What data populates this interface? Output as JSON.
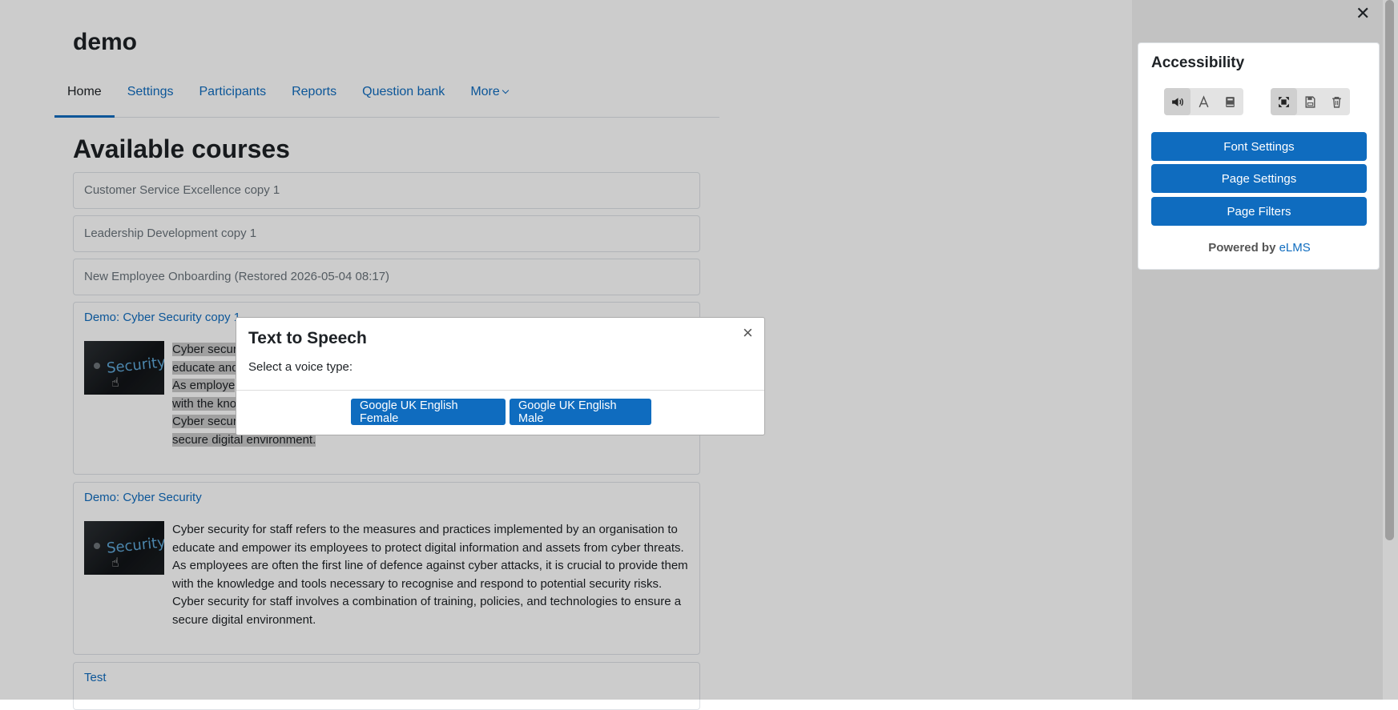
{
  "course": {
    "title": "demo"
  },
  "nav": {
    "items": [
      "Home",
      "Settings",
      "Participants",
      "Reports",
      "Question bank",
      "More"
    ]
  },
  "main": {
    "heading": "Available courses"
  },
  "courses": [
    {
      "name": "Customer Service Excellence copy 1"
    },
    {
      "name": "Leadership Development copy 1"
    },
    {
      "name": "New Employee Onboarding (Restored 2026-05-04 08:17)"
    },
    {
      "name": "Demo: Cyber Security copy 1",
      "summary_lines": [
        "Cyber secur",
        "educate and",
        "As employe",
        "with the kno",
        "Cyber secur",
        "secure digital environment."
      ]
    },
    {
      "name": "Demo: Cyber Security",
      "summary_lines": [
        "Cyber security for staff refers to the measures and practices implemented by an organisation to",
        "educate and empower its employees to protect digital information and assets from cyber threats.",
        "As employees are often the first line of defence against cyber attacks, it is crucial to provide them",
        "with the knowledge and tools necessary to recognise and respond to potential security risks.",
        "Cyber security for staff involves a combination of training, policies, and technologies to ensure a",
        "secure digital environment."
      ]
    },
    {
      "name": "Test"
    }
  ],
  "thumbnail": {
    "text": "Security"
  },
  "drawer": {
    "close_symbol": "✕"
  },
  "accessibility": {
    "title": "Accessibility",
    "tools": [
      "speaker-icon",
      "font-icon",
      "book-icon",
      "move-icon",
      "save-icon",
      "trash-icon"
    ],
    "buttons": [
      "Font Settings",
      "Page Settings",
      "Page Filters"
    ],
    "powered_prefix": "Powered by",
    "powered_link": "eLMS"
  },
  "modal": {
    "title": "Text to Speech",
    "close_symbol": "×",
    "text": "Select a voice type:",
    "voices": [
      "Google UK English Female",
      "Google UK English Male"
    ]
  },
  "colors": {
    "primary": "#0f6cbf",
    "overlay": "rgba(0,0,0,0.2)"
  }
}
